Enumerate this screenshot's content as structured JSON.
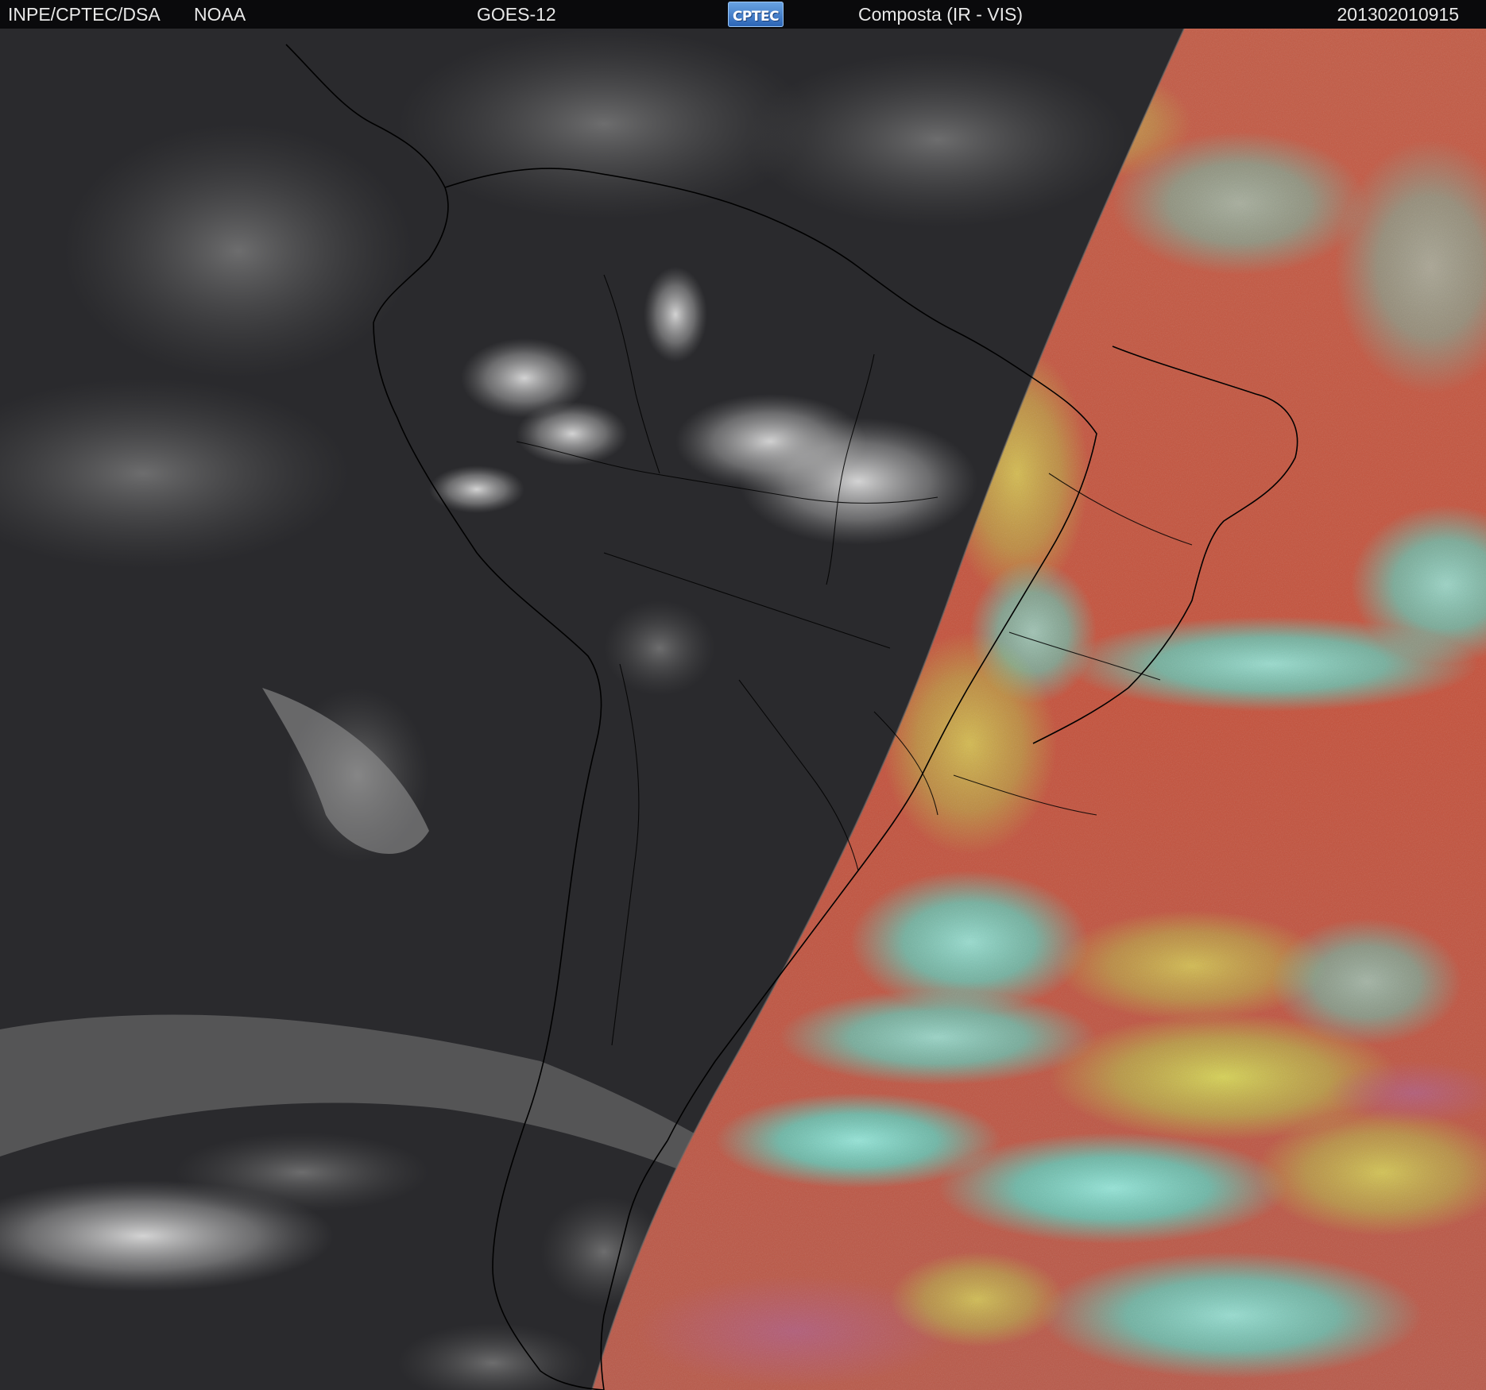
{
  "header": {
    "organization": "INPE/CPTEC/DSA",
    "agency": "NOAA",
    "satellite": "GOES-12",
    "logo_text": "CPTEC",
    "product": "Composta (IR - VIS)",
    "timestamp": "201302010915"
  },
  "colors": {
    "header_background": "#0a0a0c",
    "header_text": "#e8e8e8",
    "ir_night_side": "#2a2a2d",
    "vis_land_red": "#c8553c",
    "vis_cloud_cyan": "#40f0e0",
    "vis_cloud_yellow_green": "#c8e64a",
    "vis_ocean_magenta": "#a85a78",
    "border_lines": "#000000"
  }
}
